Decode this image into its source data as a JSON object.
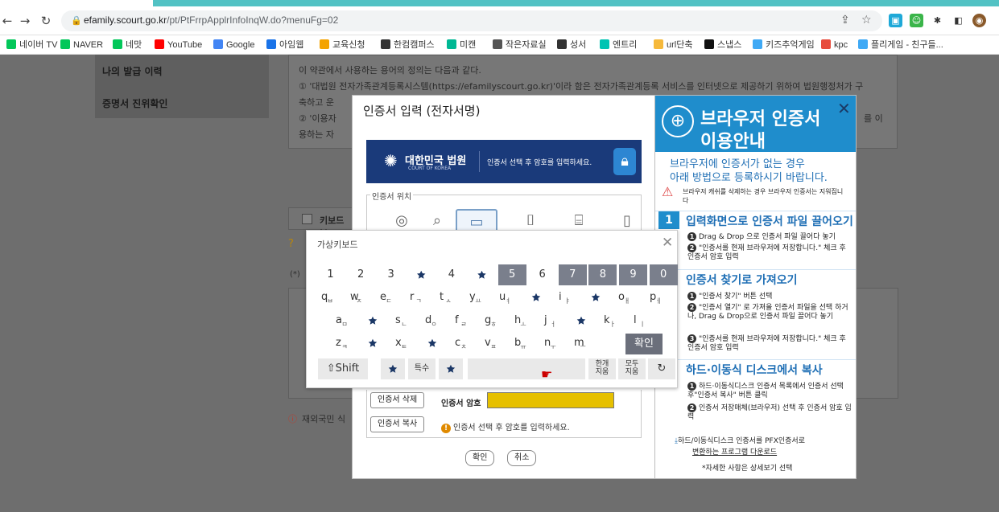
{
  "browser": {
    "url_host": "efamily.scourt.go.kr",
    "url_path": "/pt/PtFrrpApplrInfoInqW.do?menuFg=02"
  },
  "bookmarks": [
    {
      "label": "네이버 TV",
      "color": "#03c75a"
    },
    {
      "label": "NAVER",
      "color": "#03c75a"
    },
    {
      "label": "네맛",
      "color": "#03c75a"
    },
    {
      "label": "YouTube",
      "color": "#ff0000"
    },
    {
      "label": "Google",
      "color": "#4285f4"
    },
    {
      "label": "아임웹",
      "color": "#1a73e8"
    },
    {
      "label": "교육신청",
      "color": "#f4a300"
    },
    {
      "label": "한컴캠퍼스",
      "color": "#333333"
    },
    {
      "label": "미캔",
      "color": "#00b894"
    },
    {
      "label": "작은자료실",
      "color": "#555555"
    },
    {
      "label": "성서",
      "color": "#333333"
    },
    {
      "label": "엔트리",
      "color": "#00c4b3"
    },
    {
      "label": "url단축",
      "color": "#f6b93b"
    },
    {
      "label": "스냅스",
      "color": "#111111"
    },
    {
      "label": "키즈추억게임",
      "color": "#3fa9f5"
    },
    {
      "label": "kpc",
      "color": "#e74c3c"
    },
    {
      "label": "플리게임 - 친구들...",
      "color": "#3fa9f5"
    }
  ],
  "sidebar": {
    "items": [
      "나의 발급 이력",
      "증명서 진위확인"
    ]
  },
  "terms": {
    "line1": "이 약관에서 사용하는 용어의 정의는 다음과 같다.",
    "line2": "① '대법원 전자가족관계등록시스템(https://efamilyscourt.go.kr)'이라 함은 전자가족관계등록 서비스를 인터넷으로 제공하기 위하여 법원행정처가 구",
    "line3": "축하고 운",
    "line4": "② '이용자",
    "line5": "용하는 자",
    "right_fragment": "를 이"
  },
  "background_form": {
    "keyboard_label": "키보드보",
    "asterisk": "(*)",
    "foreign_note": "재외국민 식"
  },
  "cert_dialog": {
    "title": "인증서 입력 (전자서명)",
    "court_name": "대한민국 법원",
    "court_en": "COURT OF KOREA",
    "banner_text": "인증서 선택 후 암호를 입력하세요.",
    "location_legend": "인증서 위치",
    "locations": [
      {
        "icon": "globe-icon",
        "glyph": "◎"
      },
      {
        "icon": "search-cert-icon",
        "glyph": "⌕"
      },
      {
        "icon": "hard-disk-icon",
        "glyph": "▭"
      },
      {
        "icon": "usb-icon",
        "glyph": "⌷"
      },
      {
        "icon": "security-token-icon",
        "glyph": "⌸"
      },
      {
        "icon": "mobile-icon",
        "glyph": "▯"
      }
    ],
    "delete_button": "인증서 삭제",
    "copy_button": "인증서 복사",
    "password_label": "인증서 암호",
    "password_value": "",
    "hint": "인증서 선택 후 암호를 입력하세요.",
    "ok": "확인",
    "cancel": "취소",
    "colors": {
      "banner": "#1a3a7a",
      "password_field": "#e6c000"
    }
  },
  "keyboard": {
    "title": "가상키보드",
    "number_row": [
      "1",
      "2",
      "3",
      "fig",
      "4",
      "fig",
      "5",
      "6",
      "7",
      "8",
      "9",
      "0"
    ],
    "row1": [
      {
        "k": "q",
        "s": "ㅂ"
      },
      {
        "k": "w",
        "s": "ㅈ"
      },
      {
        "k": "e",
        "s": "ㄷ"
      },
      {
        "k": "r",
        "s": "ㄱ"
      },
      {
        "k": "t",
        "s": "ㅅ"
      },
      {
        "k": "y",
        "s": "ㅛ"
      },
      {
        "k": "u",
        "s": "ㅕ"
      },
      {
        "k": "fig",
        "s": ""
      },
      {
        "k": "i",
        "s": "ㅑ"
      },
      {
        "k": "fig",
        "s": ""
      },
      {
        "k": "o",
        "s": "ㅐ"
      },
      {
        "k": "p",
        "s": "ㅔ"
      }
    ],
    "row2": [
      {
        "k": "a",
        "s": "ㅁ"
      },
      {
        "k": "fig",
        "s": ""
      },
      {
        "k": "s",
        "s": "ㄴ"
      },
      {
        "k": "d",
        "s": "ㅇ"
      },
      {
        "k": "f",
        "s": "ㄹ"
      },
      {
        "k": "g",
        "s": "ㅎ"
      },
      {
        "k": "h",
        "s": "ㅗ"
      },
      {
        "k": "j",
        "s": "ㅓ"
      },
      {
        "k": "fig",
        "s": ""
      },
      {
        "k": "k",
        "s": "ㅏ"
      },
      {
        "k": "l",
        "s": "ㅣ"
      }
    ],
    "row3": [
      {
        "k": "z",
        "s": "ㅋ"
      },
      {
        "k": "fig",
        "s": ""
      },
      {
        "k": "x",
        "s": "ㅌ"
      },
      {
        "k": "fig",
        "s": ""
      },
      {
        "k": "c",
        "s": "ㅊ"
      },
      {
        "k": "v",
        "s": "ㅍ"
      },
      {
        "k": "b",
        "s": "ㅠ"
      },
      {
        "k": "n",
        "s": "ㅜ"
      },
      {
        "k": "m",
        "s": "ㅡ"
      }
    ],
    "confirm": "확인",
    "shift": "⇧Shift",
    "special": "특수",
    "delete_one": "한개\n지움",
    "delete_all": "모두\n지움",
    "refresh": "↻"
  },
  "guide": {
    "title1": "브라우저 인증서",
    "title2": "이용안내",
    "sub1": "브라우저에 인증서가 없는 경우",
    "sub2": "아래 방법으로 등록하시기 바랍니다.",
    "warning": "브라우저 캐쉬를 삭제하는 경우 브라우저 인증서는 지워집니다",
    "section1_num": "1",
    "section1": "입력화면으로 인증서 파일 끌어오기",
    "s1_lines": [
      "Drag & Drop 으로 인증서 파일 끌어다 놓기",
      "\"인증서를 현재 브라우저에 저장합니다.\" 체크 후 인증서 암호 입력"
    ],
    "section2": "인증서 찾기로 가져오기",
    "s2_lines": [
      "\"인증서 찾기\" 버튼 선택",
      "\"인증서 열기\" 로 가져올 인증서 파일을 선택 하거나, Drag & Drop으로 인증서 파일 끌어다 놓기",
      "\"인증서를 현재 브라우저에 저장합니다.\" 체크 후 인증서 암호 입력"
    ],
    "section3": "하드·이동식 디스크에서 복사",
    "s3_lines": [
      "하드·이동식디스크 인증서 목록에서 인증서 선택 후\"인증서 복사\" 버튼 클릭",
      "인증서 저장매체(브라우저) 선택 후 인증서 암호 입력"
    ],
    "download1": "하드/이동식디스크 인증서를 PFX인증서로",
    "download2": "변환하는 프로그램 다운로드",
    "detail": "*자세한 사항은 상세보기 선택",
    "accent": "#1f8dcc"
  }
}
